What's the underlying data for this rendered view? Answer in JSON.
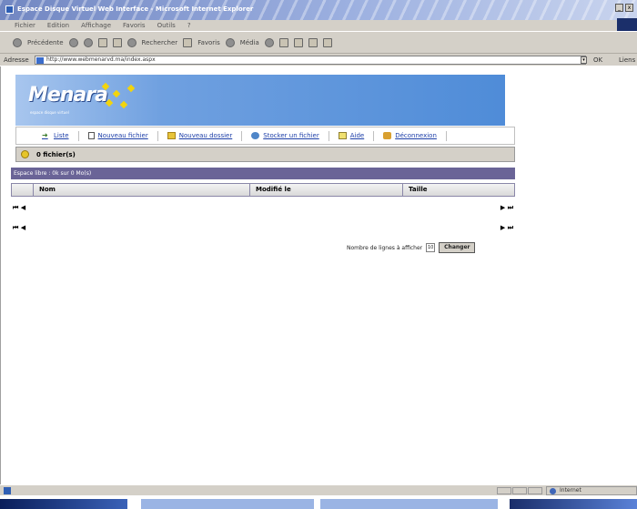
{
  "window": {
    "title": "Espace Disque Virtuel Web Interface - Microsoft Internet Explorer",
    "buttons": [
      "_",
      "x"
    ]
  },
  "menu": [
    "Fichier",
    "Edition",
    "Affichage",
    "Favoris",
    "Outils",
    "?"
  ],
  "toolbar": {
    "back": "Précédente",
    "search": "Rechercher",
    "favorites": "Favoris",
    "media": "Média"
  },
  "address": {
    "label": "Adresse",
    "url": "http://www.webmenarvd.ma/index.aspx",
    "go": "OK",
    "links": "Liens"
  },
  "banner": {
    "logo": "Menara",
    "tagline": "espace disque virtuel"
  },
  "nav": {
    "items": [
      {
        "label": "Liste",
        "icon": "arrow-right-icon"
      },
      {
        "label": "Nouveau fichier",
        "icon": "new-file-icon"
      },
      {
        "label": "Nouveau dossier",
        "icon": "folder-icon"
      },
      {
        "label": "Stocker un fichier",
        "icon": "upload-icon"
      },
      {
        "label": "Aide",
        "icon": "help-icon"
      },
      {
        "label": "Déconnexion",
        "icon": "logout-icon"
      }
    ]
  },
  "files": {
    "count_label": "0 fichier(s)",
    "space_info": "Espace libre : 0k sur 0 Mo(s)"
  },
  "table": {
    "columns": [
      "Nom",
      "Modifié le",
      "Taille"
    ]
  },
  "pager": {
    "first_prev": "⏮ ◀",
    "next_last": "▶ ⏭"
  },
  "rows_control": {
    "label": "Nombre de lignes à afficher",
    "value": "10",
    "button": "Changer"
  },
  "status": {
    "zone": "Internet"
  },
  "colors": {
    "purple_bar": "#6a6497",
    "banner_blue": "#4f8cd8",
    "link_blue": "#1d3fa8"
  }
}
